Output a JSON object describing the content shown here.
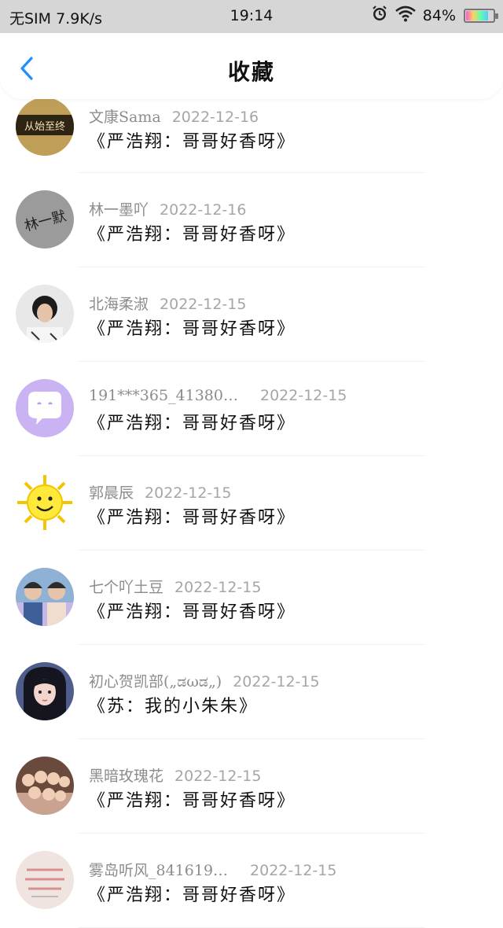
{
  "status_bar": {
    "left": "无SIM 7.9K/s",
    "time": "19:14",
    "battery": "84%",
    "battery_level": 0.84
  },
  "header": {
    "title": "收藏"
  },
  "items": [
    {
      "name": "文康Sama",
      "date": "2022-12-16",
      "content": "《严浩翔：哥哥好香呀》",
      "avatar_text": "从始至终"
    },
    {
      "name": "林一墨吖",
      "date": "2022-12-16",
      "content": "《严浩翔：哥哥好香呀》",
      "avatar_text": "林一默"
    },
    {
      "name": "北海柔淑",
      "date": "2022-12-15",
      "content": "《严浩翔：哥哥好香呀》",
      "avatar_text": ""
    },
    {
      "name": "191***365_41380…",
      "date": "2022-12-15",
      "content": "《严浩翔：哥哥好香呀》",
      "avatar_text": ""
    },
    {
      "name": "郭晨辰",
      "date": "2022-12-15",
      "content": "《严浩翔：哥哥好香呀》",
      "avatar_text": ""
    },
    {
      "name": "七个吖土豆",
      "date": "2022-12-15",
      "content": "《严浩翔：哥哥好香呀》",
      "avatar_text": ""
    },
    {
      "name": "初心贺凯部(„ಡωಡ„)",
      "date": "2022-12-15",
      "content": "《苏：我的小朱朱》",
      "avatar_text": ""
    },
    {
      "name": "黑暗玫瑰花",
      "date": "2022-12-15",
      "content": "《严浩翔：哥哥好香呀》",
      "avatar_text": ""
    },
    {
      "name": "雾岛听风_841619…",
      "date": "2022-12-15",
      "content": "《严浩翔：哥哥好香呀》",
      "avatar_text": ""
    }
  ]
}
